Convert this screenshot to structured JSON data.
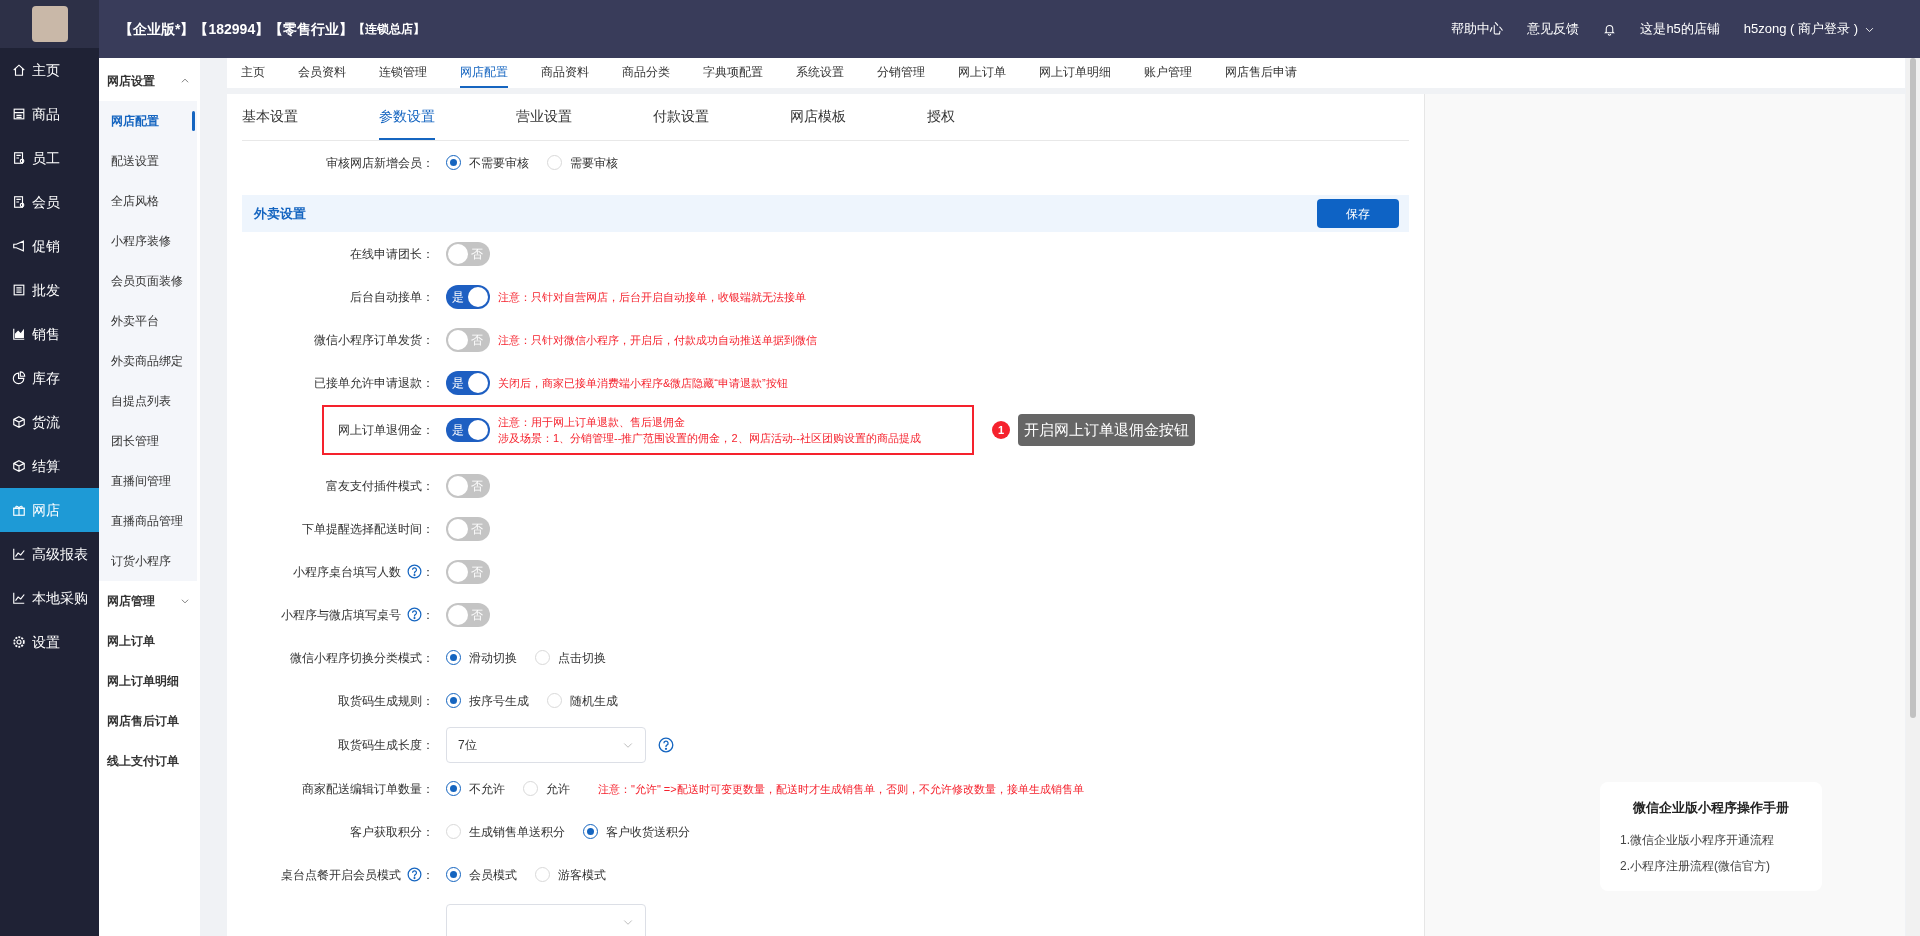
{
  "header": {
    "tags": [
      "【企业版*】",
      "【182994】",
      "【零售行业】",
      "【连锁总店】"
    ],
    "links": [
      "帮助中心",
      "意见反馈"
    ],
    "store_name": "这是h5的店铺",
    "user": "h5zong ( 商户登录 )"
  },
  "sidebar": {
    "items": [
      {
        "label": "主页",
        "selected": false
      },
      {
        "label": "商品",
        "selected": false
      },
      {
        "label": "员工",
        "selected": false
      },
      {
        "label": "会员",
        "selected": false
      },
      {
        "label": "促销",
        "selected": false
      },
      {
        "label": "批发",
        "selected": false
      },
      {
        "label": "销售",
        "selected": false
      },
      {
        "label": "库存",
        "selected": false
      },
      {
        "label": "货流",
        "selected": false
      },
      {
        "label": "结算",
        "selected": false
      },
      {
        "label": "网店",
        "selected": true
      },
      {
        "label": "高级报表",
        "selected": false
      },
      {
        "label": "本地采购",
        "selected": false
      },
      {
        "label": "设置",
        "selected": false
      }
    ]
  },
  "submenu": {
    "groups": [
      {
        "title": "网店设置",
        "expanded": true,
        "items": [
          {
            "label": "网店配置",
            "selected": true
          },
          {
            "label": "配送设置",
            "selected": false
          },
          {
            "label": "全店风格",
            "selected": false
          },
          {
            "label": "小程序装修",
            "selected": false
          },
          {
            "label": "会员页面装修",
            "selected": false
          },
          {
            "label": "外卖平台",
            "selected": false
          },
          {
            "label": "外卖商品绑定",
            "selected": false
          },
          {
            "label": "自提点列表",
            "selected": false
          },
          {
            "label": "团长管理",
            "selected": false
          },
          {
            "label": "直播间管理",
            "selected": false
          },
          {
            "label": "直播商品管理",
            "selected": false
          },
          {
            "label": "订货小程序",
            "selected": false
          }
        ]
      },
      {
        "title": "网店管理",
        "expanded": false,
        "items": [
          {
            "label": "网上订单",
            "selected": false
          },
          {
            "label": "网上订单明细",
            "selected": false
          },
          {
            "label": "网店售后订单",
            "selected": false
          },
          {
            "label": "线上支付订单",
            "selected": false
          }
        ]
      }
    ]
  },
  "top_tabs": [
    {
      "label": "主页",
      "selected": false
    },
    {
      "label": "会员资料",
      "selected": false
    },
    {
      "label": "连锁管理",
      "selected": false
    },
    {
      "label": "网店配置",
      "selected": true
    },
    {
      "label": "商品资料",
      "selected": false
    },
    {
      "label": "商品分类",
      "selected": false
    },
    {
      "label": "字典项配置",
      "selected": false
    },
    {
      "label": "系统设置",
      "selected": false
    },
    {
      "label": "分销管理",
      "selected": false
    },
    {
      "label": "网上订单",
      "selected": false
    },
    {
      "label": "网上订单明细",
      "selected": false
    },
    {
      "label": "账户管理",
      "selected": false
    },
    {
      "label": "网店售后申请",
      "selected": false
    }
  ],
  "sub_tabs": [
    {
      "label": "基本设置",
      "selected": false
    },
    {
      "label": "参数设置",
      "selected": true
    },
    {
      "label": "营业设置",
      "selected": false
    },
    {
      "label": "付款设置",
      "selected": false
    },
    {
      "label": "网店模板",
      "selected": false
    },
    {
      "label": "授权",
      "selected": false
    }
  ],
  "form": {
    "rows": [
      {
        "kind": "radio",
        "label": "审核网店新增会员",
        "colon": "：",
        "options": [
          {
            "label": "不需要审核",
            "selected": true
          },
          {
            "label": "需要审核",
            "selected": false
          }
        ]
      },
      {
        "kind": "section",
        "title": "外卖设置",
        "button": "保存"
      },
      {
        "kind": "switch",
        "label": "在线申请团长",
        "colon": "：",
        "on": false,
        "text": "否"
      },
      {
        "kind": "switch",
        "label": "后台自动接单",
        "colon": "：",
        "on": true,
        "text": "是",
        "notes": [
          "注意：只针对自营网店，后台开启自动接单，收银端就无法接单"
        ]
      },
      {
        "kind": "switch",
        "label": "微信小程序订单发货",
        "colon": "：",
        "on": false,
        "text": "否",
        "notes": [
          "注意：只针对微信小程序，开启后，付款成功自动推送单据到微信"
        ]
      },
      {
        "kind": "switch",
        "label": "已接单允许申请退款",
        "colon": "：",
        "on": true,
        "text": "是",
        "notes": [
          "关闭后，商家已接单消费端小程序&微店隐藏“申请退款”按钮"
        ]
      },
      {
        "kind": "switch",
        "label": "网上订单退佣金",
        "colon": "：",
        "on": true,
        "text": "是",
        "highlighted": true,
        "notes": [
          "注意：用于网上订单退款、售后退佣金",
          "涉及场景：1、分销管理--推广范围设置的佣金，2、网店活动--社区团购设置的商品提成"
        ],
        "callout": {
          "number": "1",
          "text": "开启网上订单退佣金按钮"
        }
      },
      {
        "kind": "switch",
        "label": "富友支付插件模式",
        "colon": "：",
        "on": false,
        "text": "否"
      },
      {
        "kind": "switch",
        "label": "下单提醒选择配送时间",
        "colon": "：",
        "on": false,
        "text": "否"
      },
      {
        "kind": "switch",
        "label": "小程序桌台填写人数",
        "colon": "：",
        "on": false,
        "text": "否",
        "help": true
      },
      {
        "kind": "switch",
        "label": "小程序与微店填写桌号",
        "colon": "：",
        "on": false,
        "text": "否",
        "help": true
      },
      {
        "kind": "radio",
        "label": "微信小程序切换分类模式",
        "colon": "：",
        "options": [
          {
            "label": "滑动切换",
            "selected": true
          },
          {
            "label": "点击切换",
            "selected": false
          }
        ]
      },
      {
        "kind": "radio",
        "label": "取货码生成规则",
        "colon": "：",
        "options": [
          {
            "label": "按序号生成",
            "selected": true
          },
          {
            "label": "随机生成",
            "selected": false
          }
        ]
      },
      {
        "kind": "select",
        "label": "取货码生成长度",
        "colon": "：",
        "value": "7位",
        "help_after": true
      },
      {
        "kind": "radio",
        "label": "商家配送编辑订单数量",
        "colon": "：",
        "options": [
          {
            "label": "不允许",
            "selected": true
          },
          {
            "label": "允许",
            "selected": false
          }
        ],
        "notes": [
          "注意：\"允许\" =>配送时可变更数量，配送时才生成销售单，否则，不允许修改数量，接单生成销售单"
        ]
      },
      {
        "kind": "radio",
        "label": "客户获取积分",
        "colon": "：",
        "options": [
          {
            "label": "生成销售单送积分",
            "selected": false
          },
          {
            "label": "客户收货送积分",
            "selected": true
          }
        ]
      },
      {
        "kind": "radio",
        "label": "桌台点餐开启会员模式",
        "colon": "：",
        "help": true,
        "options": [
          {
            "label": "会员模式",
            "selected": true
          },
          {
            "label": "游客模式",
            "selected": false
          }
        ]
      },
      {
        "kind": "select"
      }
    ]
  },
  "manual": {
    "title": "微信企业版小程序操作手册",
    "links": [
      "1.微信企业版小程序开通流程",
      "2.小程序注册流程(微信官方)"
    ]
  }
}
